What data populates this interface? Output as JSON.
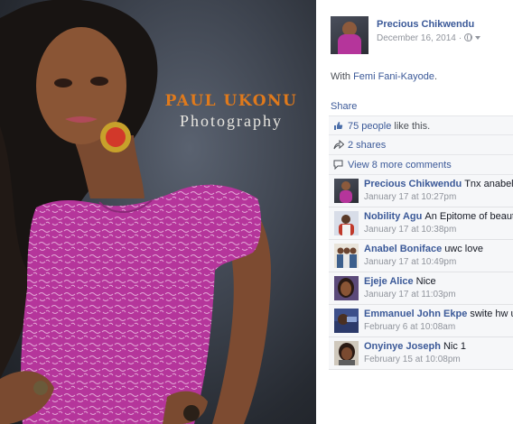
{
  "photo": {
    "watermark_name": "PAUL UKONU",
    "watermark_sub": "Photography"
  },
  "post": {
    "author": "Precious Chikwendu",
    "date": "December 16, 2014",
    "meta_separator": "·",
    "with_prefix": "With",
    "tagged": "Femi Fani-Kayode",
    "tagged_suffix": ".",
    "privacy_icon": "globe-icon",
    "menu_icon": "chevron-down-icon"
  },
  "actions": {
    "share_label": "Share",
    "likes_link": "75 people",
    "likes_suffix": "like this.",
    "shares": "2 shares",
    "more_comments": "View 8 more comments"
  },
  "comments": [
    {
      "name": "Precious Chikwendu",
      "text": "Tnx anabel",
      "time": "January 17 at 10:27pm"
    },
    {
      "name": "Nobility Agu",
      "text": "An Epitome of beauty",
      "time": "January 17 at 10:38pm"
    },
    {
      "name": "Anabel Boniface",
      "text": "uwc love",
      "time": "January 17 at 10:49pm"
    },
    {
      "name": "Ejeje Alice",
      "text": "Nice",
      "time": "January 17 at 11:03pm"
    },
    {
      "name": "Emmanuel John Ekpe",
      "text": "swite hw u",
      "time": "February 6 at 10:08am"
    },
    {
      "name": "Onyinye Joseph",
      "text": "Nic 1",
      "time": "February 15 at 10:08pm"
    }
  ],
  "colors": {
    "link": "#3b5998",
    "panel_bg": "#f6f7f9",
    "watermark_orange": "#e07a1c",
    "dress": "#b5359b"
  }
}
